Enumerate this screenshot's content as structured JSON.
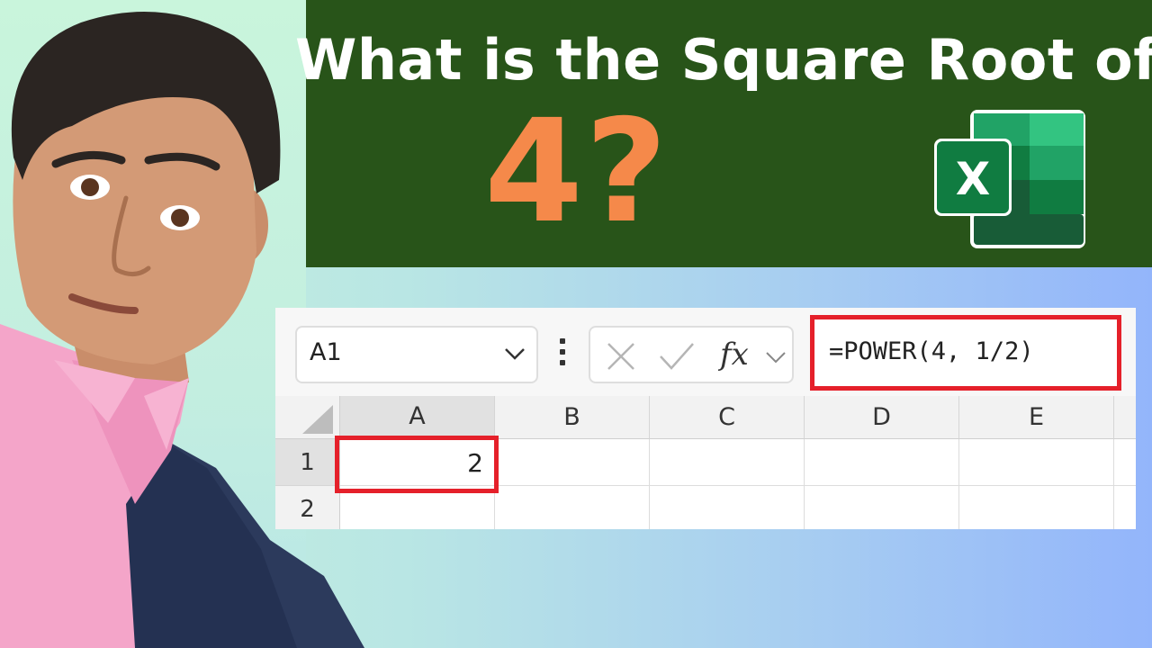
{
  "thumbnail": {
    "title": "What is the Square Root of",
    "number": "4?"
  },
  "colors": {
    "banner": "#285419",
    "number": "#f5894a",
    "highlight": "#e5202a",
    "excel_green": "#1e7145"
  },
  "excel_logo": {
    "letter": "X"
  },
  "formula_bar": {
    "name_box": "A1",
    "fx_label": "fx",
    "formula": "=POWER(4, 1/2)"
  },
  "grid": {
    "columns": [
      "A",
      "B",
      "C",
      "D",
      "E"
    ],
    "rows": [
      "1",
      "2"
    ],
    "cells": {
      "A1": "2"
    }
  }
}
